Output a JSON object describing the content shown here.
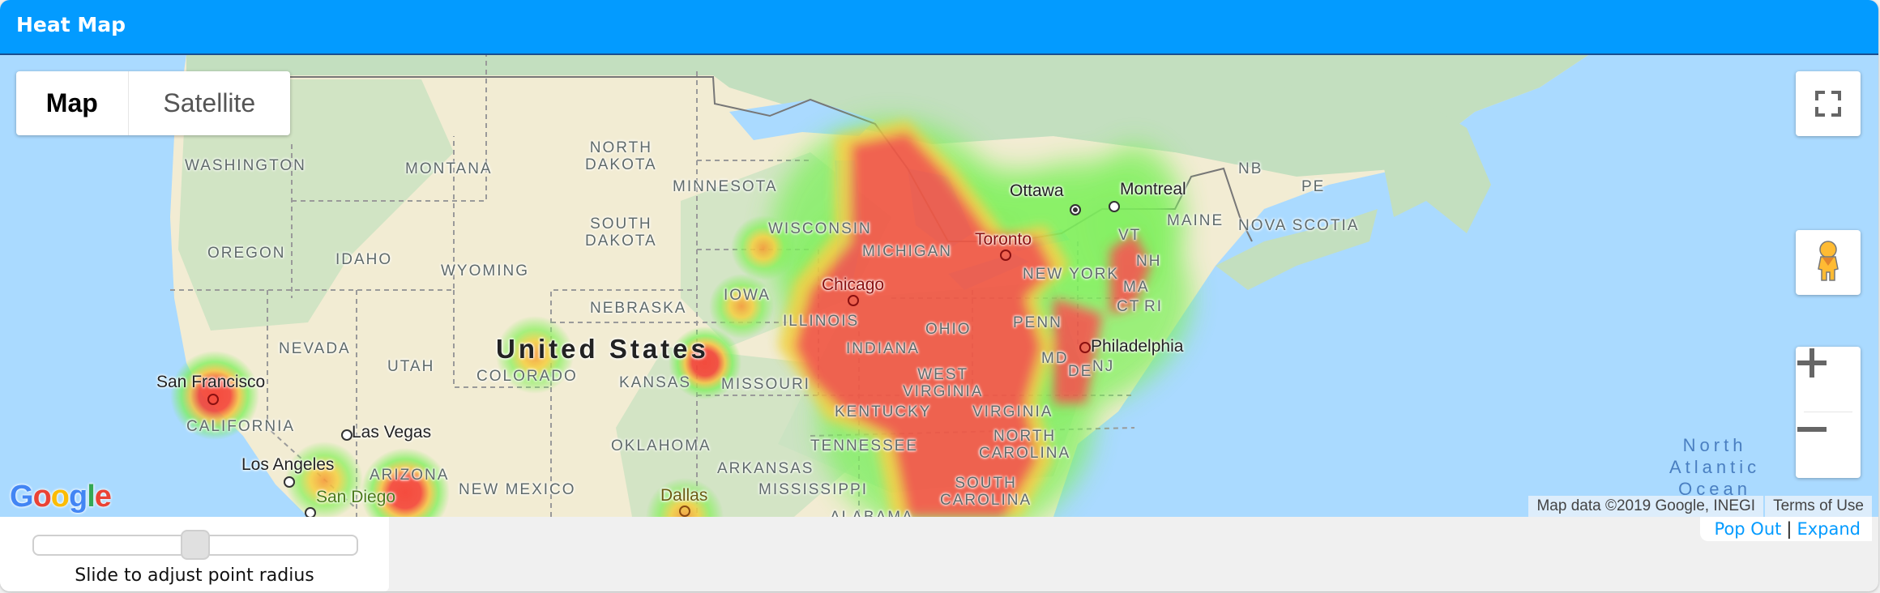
{
  "header": {
    "title": "Heat Map"
  },
  "map": {
    "map_type_control": {
      "map_label": "Map",
      "satellite_label": "Satellite",
      "selected": "Map"
    },
    "controls": {
      "fullscreen_icon": "fullscreen-icon",
      "pegman_icon": "street-view-pegman-icon",
      "zoom_in_icon": "plus-icon",
      "zoom_out_icon": "minus-icon"
    },
    "labels": {
      "country": "United States",
      "states": [
        "WASHINGTON",
        "MONTANA",
        "NORTH\nDAKOTA",
        "MINNESOTA",
        "OREGON",
        "IDAHO",
        "SOUTH\nDAKOTA",
        "WISCONSIN",
        "MICHIGAN",
        "WYOMING",
        "IOWA",
        "NEBRASKA",
        "ILLINOIS",
        "NEVADA",
        "UTAH",
        "INDIANA",
        "OHIO",
        "PENN",
        "NEW YORK",
        "COLORADO",
        "KANSAS",
        "MISSOURI",
        "WEST\nVIRGINIA",
        "VIRGINIA",
        "KENTUCKY",
        "CALIFORNIA",
        "OKLAHOMA",
        "ARKANSAS",
        "TENNESSEE",
        "NORTH\nCAROLINA",
        "ARIZONA",
        "NEW MEXICO",
        "MISSISSIPPI",
        "SOUTH\nCAROLINA",
        "ALABAMA",
        "MAINE",
        "VT",
        "NH",
        "MA",
        "CT",
        "RI",
        "MD",
        "DE",
        "NJ",
        "NB",
        "PE",
        "NOVA SCOTIA"
      ],
      "cities": [
        "Ottawa",
        "Montreal",
        "Toronto",
        "Chicago",
        "Philadelphia",
        "San Francisco",
        "Las Vegas",
        "Los Angeles",
        "San Diego",
        "Dallas"
      ],
      "ocean": "North\nAtlantic\nOcean"
    },
    "heat_colors": {
      "low": "#7cf05a",
      "mid": "#f4d03f",
      "high": "#f44336"
    },
    "google_logo": "Google",
    "attribution": {
      "data": "Map data ©2019 Google, INEGI",
      "terms": "Terms of Use"
    }
  },
  "slider": {
    "label": "Slide to adjust point radius",
    "value_fraction": 0.5
  },
  "links": {
    "pop_out": "Pop Out",
    "separator": "|",
    "expand": "Expand"
  }
}
